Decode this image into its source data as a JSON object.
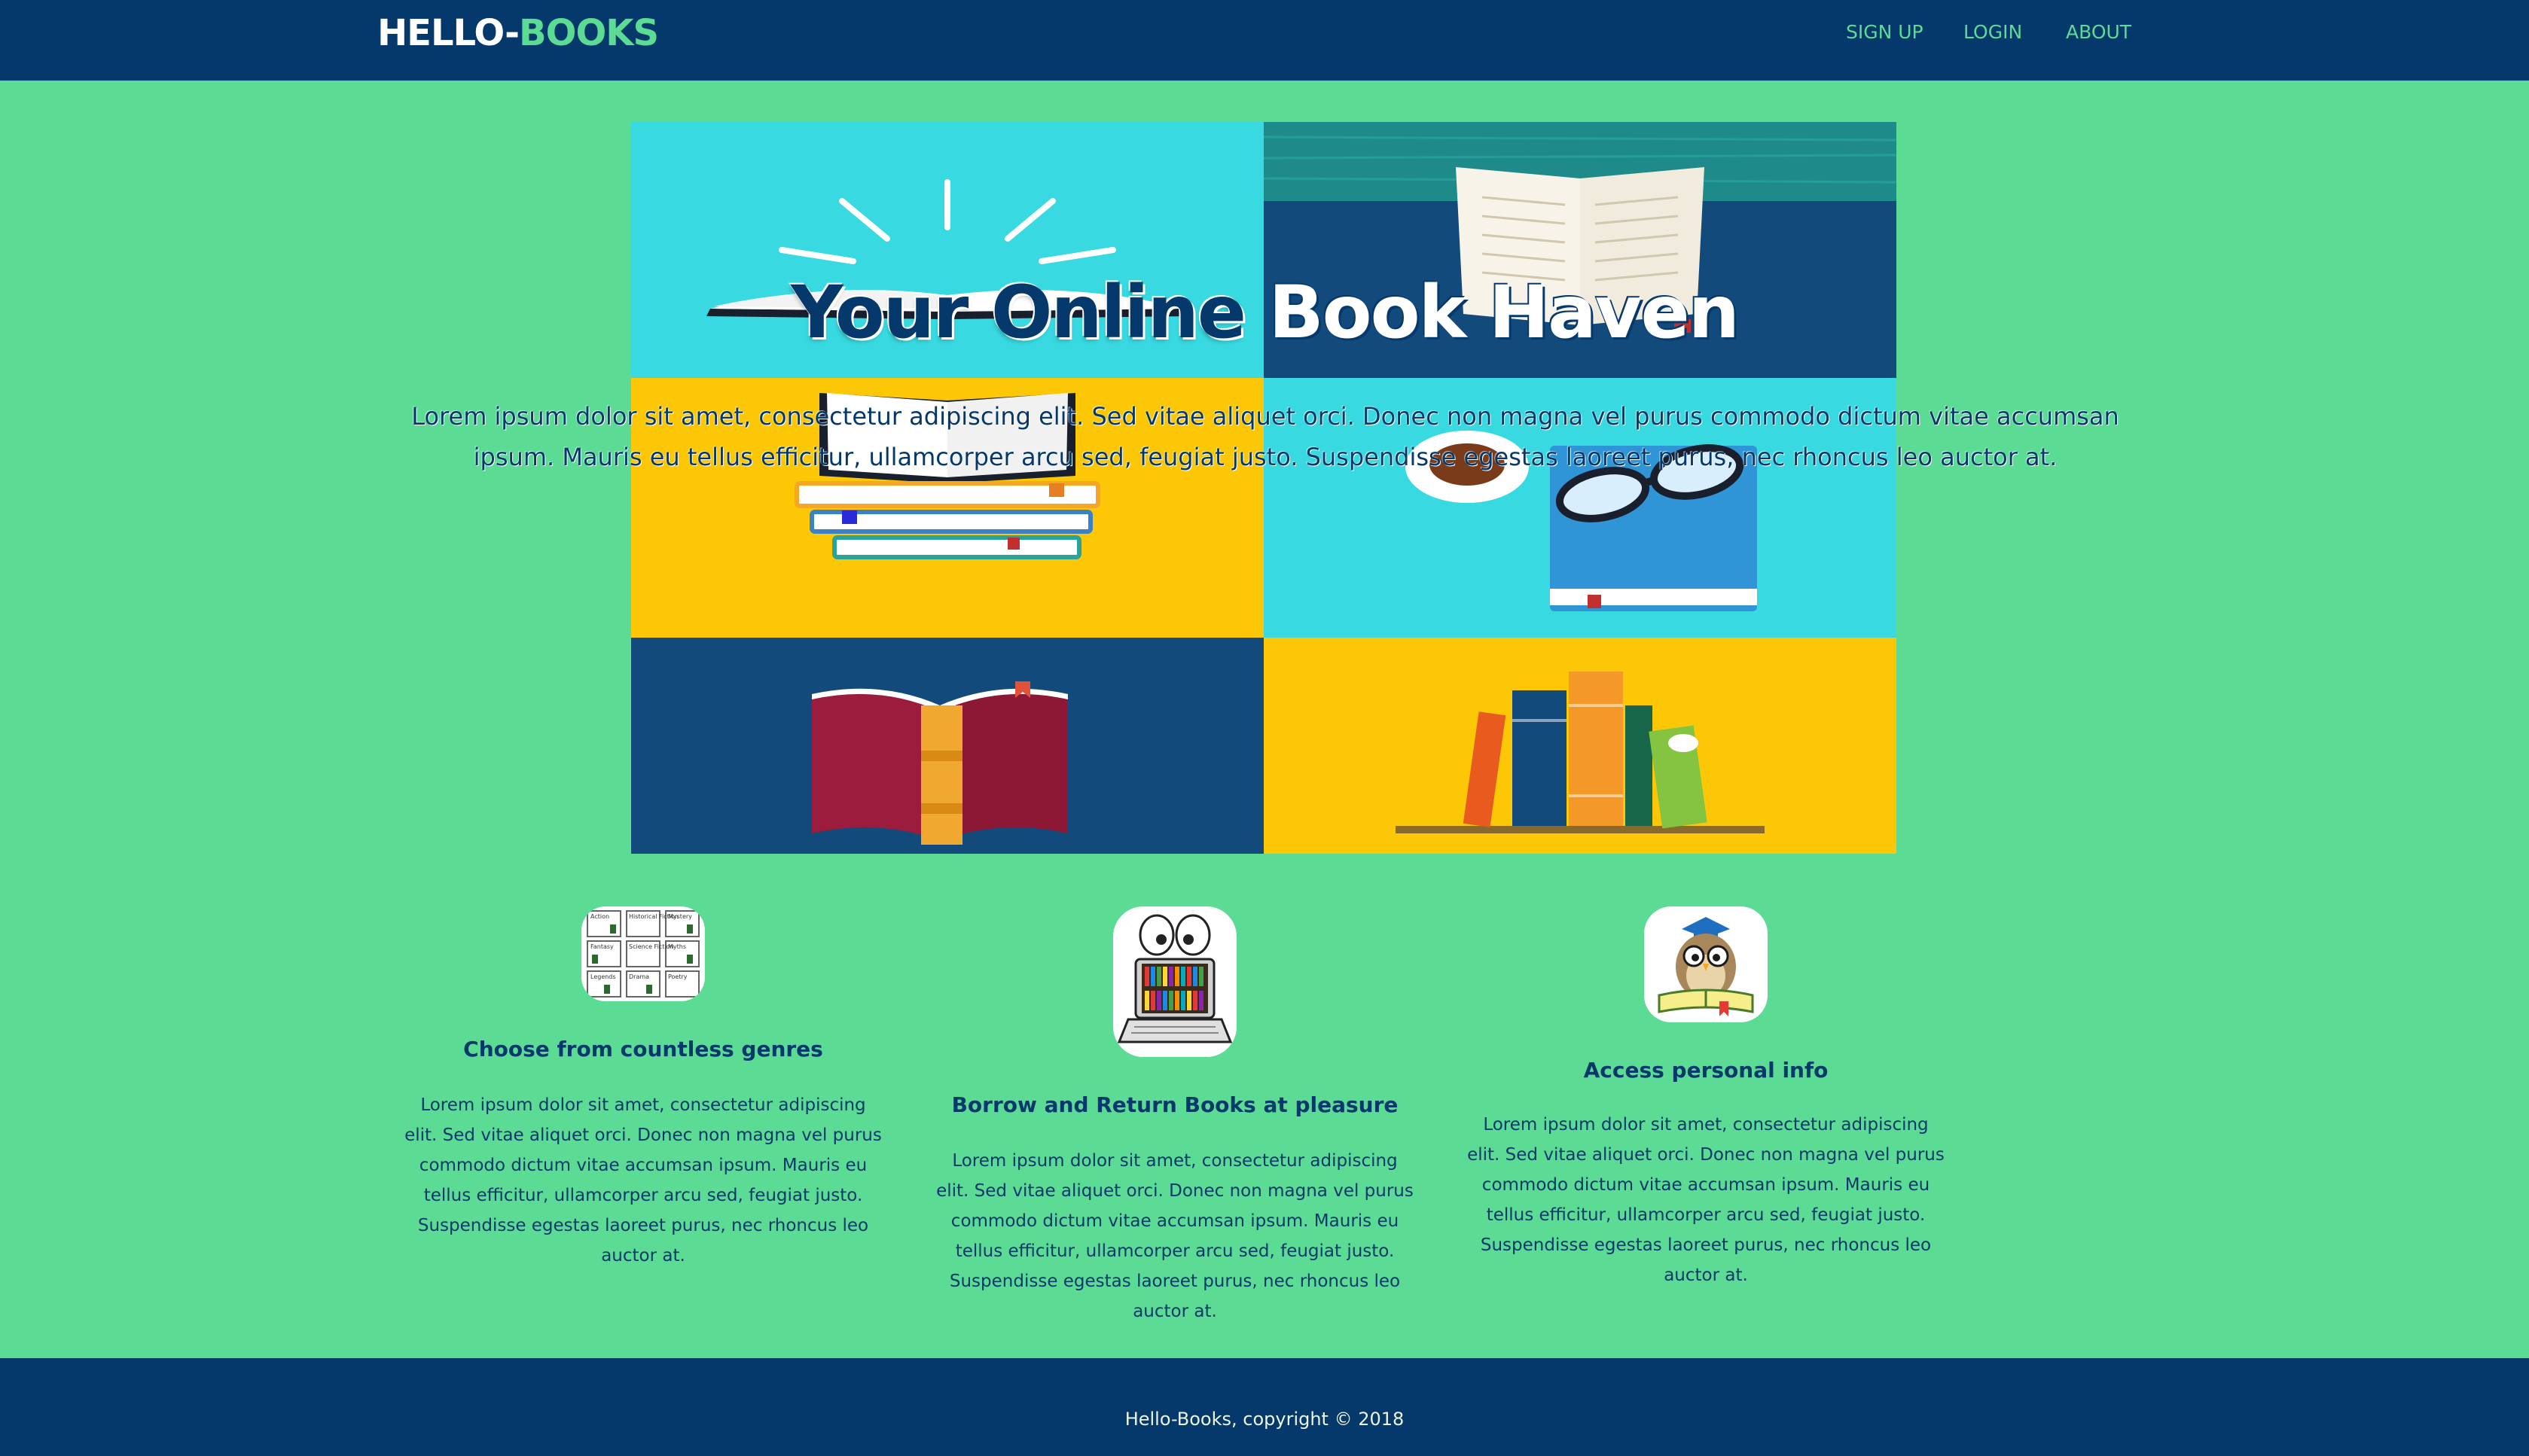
{
  "brand": {
    "part1": "HELLO-",
    "part2": "BOOKS"
  },
  "nav": {
    "signup": "SIGN UP",
    "login": "LOGIN",
    "about": "ABOUT"
  },
  "hero": {
    "title_part1": "Your Online",
    "title_part2": "Book Haven",
    "text": "Lorem ipsum dolor sit amet, consectetur adipiscing elit. Sed vitae aliquet orci. Donec non magna vel purus commodo dictum vitae accumsan ipsum. Mauris eu tellus efficitur, ullamcorper arcu sed, feugiat justo. Suspendisse egestas laoreet purus, nec rhoncus leo auctor at."
  },
  "features": [
    {
      "icon": "genres-grid-icon",
      "title": "Choose from countless genres",
      "text": "Lorem ipsum dolor sit amet, consectetur adipiscing elit. Sed vitae aliquet orci. Donec non magna vel purus commodo dictum vitae accumsan ipsum. Mauris eu tellus efficitur, ullamcorper arcu sed, feugiat justo. Suspendisse egestas laoreet purus, nec rhoncus leo auctor at.",
      "genre_labels": [
        "Action",
        "Historical Fiction",
        "Mystery",
        "Fantasy",
        "Science Fiction",
        "Myths",
        "Legends",
        "Drama",
        "Poetry"
      ]
    },
    {
      "icon": "laptop-bookshelf-icon",
      "title": "Borrow and Return Books at pleasure",
      "text": "Lorem ipsum dolor sit amet, consectetur adipiscing elit. Sed vitae aliquet orci. Donec non magna vel purus commodo dictum vitae accumsan ipsum. Mauris eu tellus efficitur, ullamcorper arcu sed, feugiat justo. Suspendisse egestas laoreet purus, nec rhoncus leo auctor at."
    },
    {
      "icon": "owl-reading-icon",
      "title": "Access personal info",
      "text": "Lorem ipsum dolor sit amet, consectetur adipiscing elit. Sed vitae aliquet orci. Donec non magna vel purus commodo dictum vitae accumsan ipsum. Mauris eu tellus efficitur, ullamcorper arcu sed, feugiat justo. Suspendisse egestas laoreet purus, nec rhoncus leo auctor at."
    }
  ],
  "footer": {
    "text": "Hello-Books, copyright © 2018"
  },
  "colors": {
    "background": "#5cdb95",
    "navy": "#05386b",
    "cyan": "#38d9e0",
    "yellow": "#fcc707",
    "white": "#ffffff"
  }
}
